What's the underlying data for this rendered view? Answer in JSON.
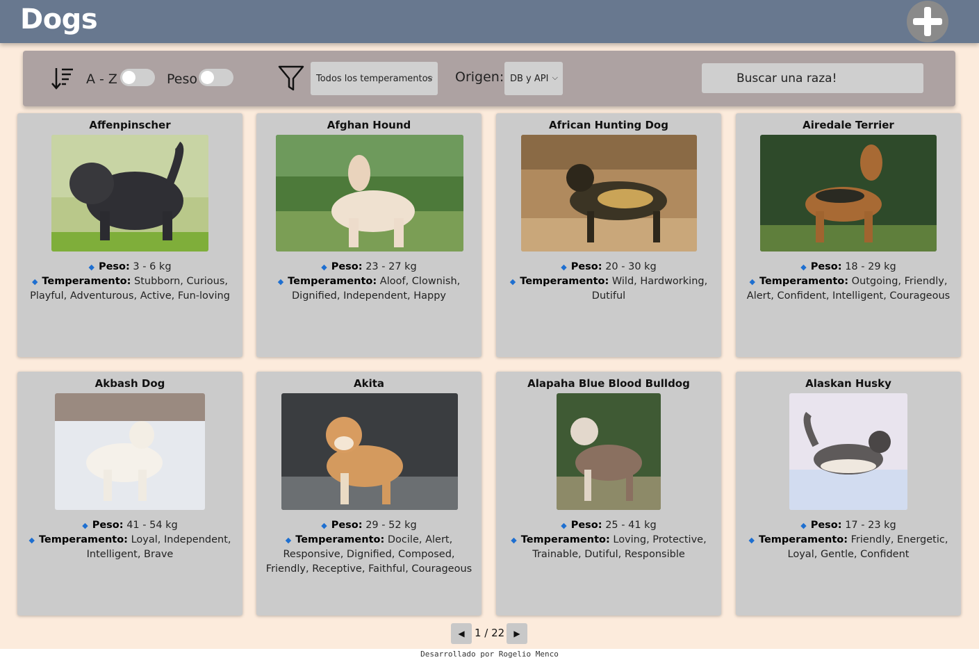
{
  "header": {
    "title": "Dogs",
    "add_icon": "plus-icon"
  },
  "toolbar": {
    "sort_icon": "sort-descending-icon",
    "alpha_label": "A - Z",
    "weight_label": "Peso",
    "filter_icon": "filter-funnel-icon",
    "temperament_select": "Todos los temperamentos",
    "origin_label": "Origen:",
    "origin_select": "DB y API",
    "search_placeholder": "Buscar una raza!"
  },
  "labels": {
    "weight": "Peso:",
    "temperament": "Temperamento:"
  },
  "cards": [
    {
      "name": "Affenpinscher",
      "weight": "3 - 6 kg",
      "temperament": "Stubborn, Curious, Playful, Adventurous, Active, Fun-loving"
    },
    {
      "name": "Afghan Hound",
      "weight": "23 - 27 kg",
      "temperament": "Aloof, Clownish, Dignified, Independent, Happy"
    },
    {
      "name": "African Hunting Dog",
      "weight": "20 - 30 kg",
      "temperament": "Wild, Hardworking, Dutiful"
    },
    {
      "name": "Airedale Terrier",
      "weight": "18 - 29 kg",
      "temperament": "Outgoing, Friendly, Alert, Confident, Intelligent, Courageous"
    },
    {
      "name": "Akbash Dog",
      "weight": "41 - 54 kg",
      "temperament": "Loyal, Independent, Intelligent, Brave"
    },
    {
      "name": "Akita",
      "weight": "29 - 52 kg",
      "temperament": "Docile, Alert, Responsive, Dignified, Composed, Friendly, Receptive, Faithful, Courageous"
    },
    {
      "name": "Alapaha Blue Blood Bulldog",
      "weight": "25 - 41 kg",
      "temperament": "Loving, Protective, Trainable, Dutiful, Responsible"
    },
    {
      "name": "Alaskan Husky",
      "weight": "17 - 23 kg",
      "temperament": "Friendly, Energetic, Loyal, Gentle, Confident"
    }
  ],
  "pagination": {
    "current": "1 / 22",
    "prev_icon": "arrow-left-icon",
    "next_icon": "arrow-right-icon"
  },
  "footer": {
    "text": "Desarrollado por Rogelio Menco"
  }
}
